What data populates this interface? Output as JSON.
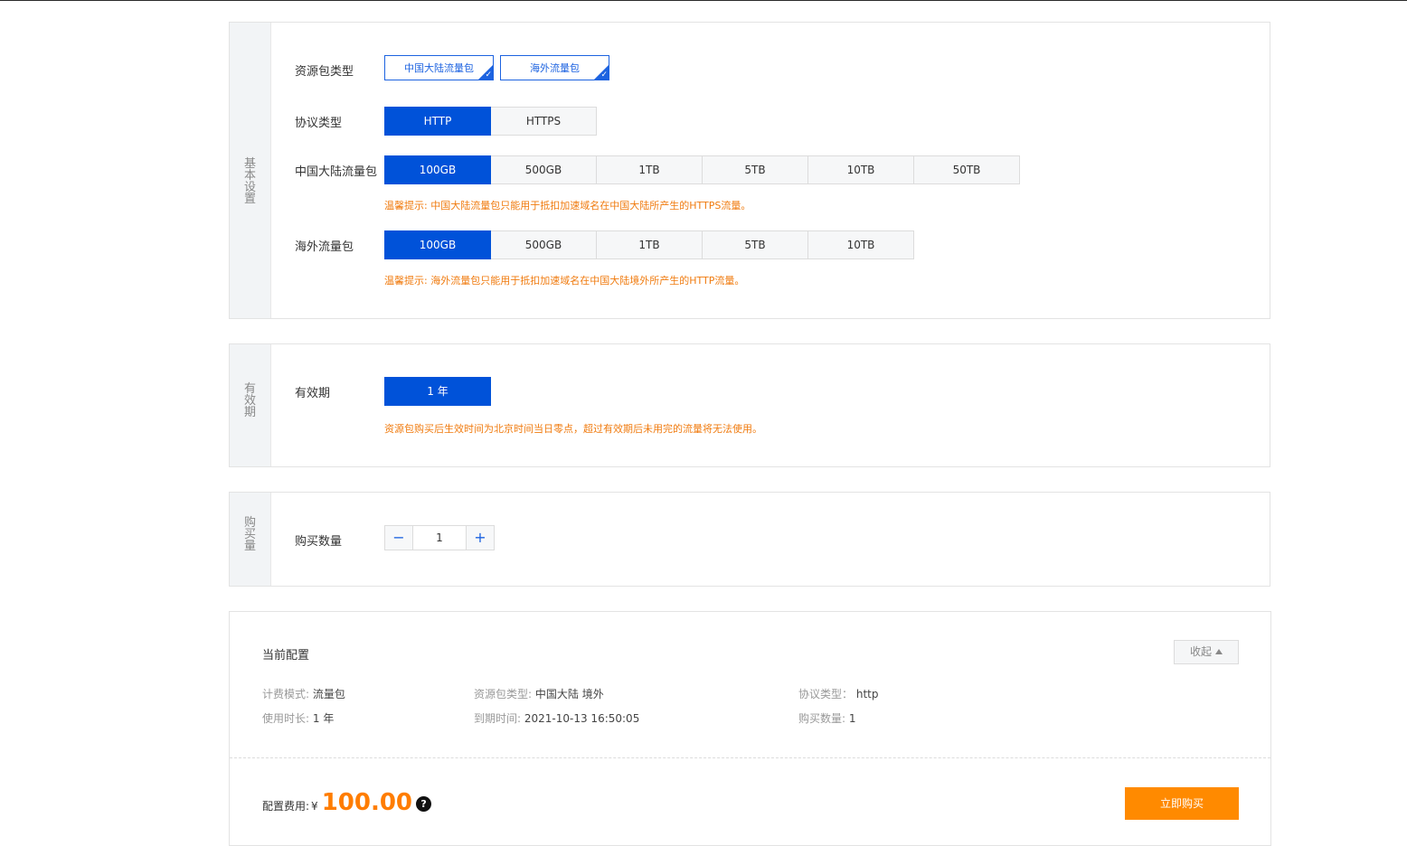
{
  "basic": {
    "side_label": "基本设置",
    "pkg_type_label": "资源包类型",
    "pkg_types": [
      "中国大陆流量包",
      "海外流量包"
    ],
    "protocol_label": "协议类型",
    "protocols": [
      "HTTP",
      "HTTPS"
    ],
    "protocol_selected": "HTTP",
    "mainland_label": "中国大陆流量包",
    "mainland_sizes": [
      "100GB",
      "500GB",
      "1TB",
      "5TB",
      "10TB",
      "50TB"
    ],
    "mainland_selected": "100GB",
    "mainland_hint": "温馨提示: 中国大陆流量包只能用于抵扣加速域名在中国大陆所产生的HTTPS流量。",
    "overseas_label": "海外流量包",
    "overseas_sizes": [
      "100GB",
      "500GB",
      "1TB",
      "5TB",
      "10TB"
    ],
    "overseas_selected": "100GB",
    "overseas_hint": "温馨提示: 海外流量包只能用于抵扣加速域名在中国大陆境外所产生的HTTP流量。"
  },
  "validity": {
    "side_label": "有效期",
    "label": "有效期",
    "option": "1 年",
    "hint": "资源包购买后生效时间为北京时间当日零点，超过有效期后未用完的流量将无法使用。"
  },
  "quantity": {
    "side_label": "购买量",
    "label": "购买数量",
    "minus": "−",
    "value": "1",
    "plus": "+"
  },
  "summary": {
    "title": "当前配置",
    "collapse_label": "收起",
    "billing_mode_label": "计费模式:",
    "billing_mode_value": "流量包",
    "pkg_type_label": "资源包类型:",
    "pkg_type_value": "中国大陆 境外",
    "protocol_label": "协议类型：",
    "protocol_value": "http",
    "duration_label": "使用时长:",
    "duration_value": "1 年",
    "expire_label": "到期时间:",
    "expire_value": "2021-10-13 16:50:05",
    "qty_label": "购买数量:",
    "qty_value": "1",
    "fee_label": "配置费用:",
    "currency": "¥",
    "amount": "100.00",
    "help_glyph": "?",
    "buy_label": "立即购买"
  },
  "colors": {
    "accent_blue": "#0052d9",
    "warning_orange": "#f07b0f",
    "buy_orange": "#ff8a00"
  }
}
